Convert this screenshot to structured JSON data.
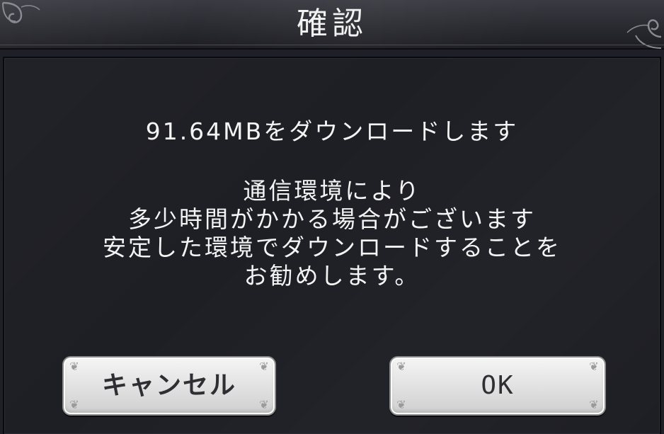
{
  "dialog": {
    "title": "確認",
    "size_line": "91.64MBをダウンロードします",
    "lines": [
      "通信環境により",
      "多少時間がかかる場合がございます",
      "安定した環境でダウンロードすることを",
      "お勧めします。"
    ]
  },
  "buttons": {
    "cancel_label": "キャンセル",
    "ok_label": "OK"
  },
  "icons": {
    "title_ornament": "scroll-ornament-icon",
    "button_corner": "fleur-ornament-icon"
  }
}
